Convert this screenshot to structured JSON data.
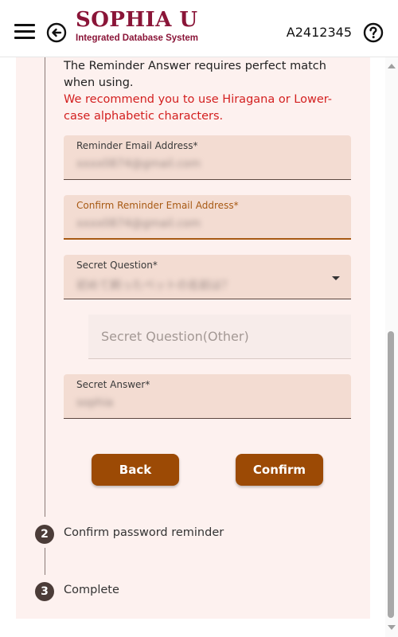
{
  "header": {
    "logo_title_main": "SOPHIA U",
    "logo_subtitle": "Integrated Database System",
    "user_id": "A2412345",
    "icons": {
      "menu": "hamburger-icon",
      "back": "back-arrow-icon",
      "help": "help-icon"
    }
  },
  "form": {
    "note_line": "The Reminder Answer requires perfect match when using.",
    "note_warning": "We recommend you to use Hiragana or Lower-case alphabetic characters.",
    "reminder_email": {
      "label": "Reminder Email Address*",
      "value": "xxxx0874@gmail.com"
    },
    "confirm_email": {
      "label": "Confirm Reminder Email Address*",
      "value": "xxxx0874@gmail.com"
    },
    "secret_question": {
      "label": "Secret Question*",
      "value": "初めて飼ったペットの名前は？"
    },
    "secret_question_other": {
      "placeholder": "Secret Question(Other)"
    },
    "secret_answer": {
      "label": "Secret Answer*",
      "value": "sophia"
    },
    "back_label": "Back",
    "confirm_label": "Confirm"
  },
  "steps": [
    {
      "number": "2",
      "label": "Confirm password reminder"
    },
    {
      "number": "3",
      "label": "Complete"
    }
  ],
  "colors": {
    "brand": "#8a1538",
    "button": "#9c4a05",
    "card": "#fdf1ef",
    "warning": "#d31f1f"
  }
}
